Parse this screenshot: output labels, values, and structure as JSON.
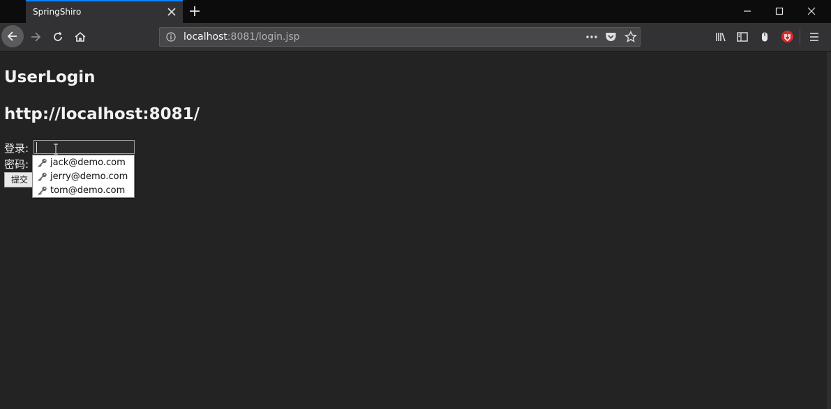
{
  "browser": {
    "tab_title": "SpringShiro",
    "url_host": "localhost",
    "url_rest": ":8081/login.jsp",
    "accent": "#0a84ff"
  },
  "page": {
    "title": "UserLogin",
    "subtitle": "http://localhost:8081/",
    "login_label": "登录:",
    "password_label": "密码:",
    "submit_label": "提交",
    "login_value": ""
  },
  "autocomplete": {
    "items": [
      {
        "icon": "key-icon",
        "label": "jack@demo.com"
      },
      {
        "icon": "key-icon",
        "label": "jerry@demo.com"
      },
      {
        "icon": "key-icon",
        "label": "tom@demo.com"
      }
    ]
  }
}
